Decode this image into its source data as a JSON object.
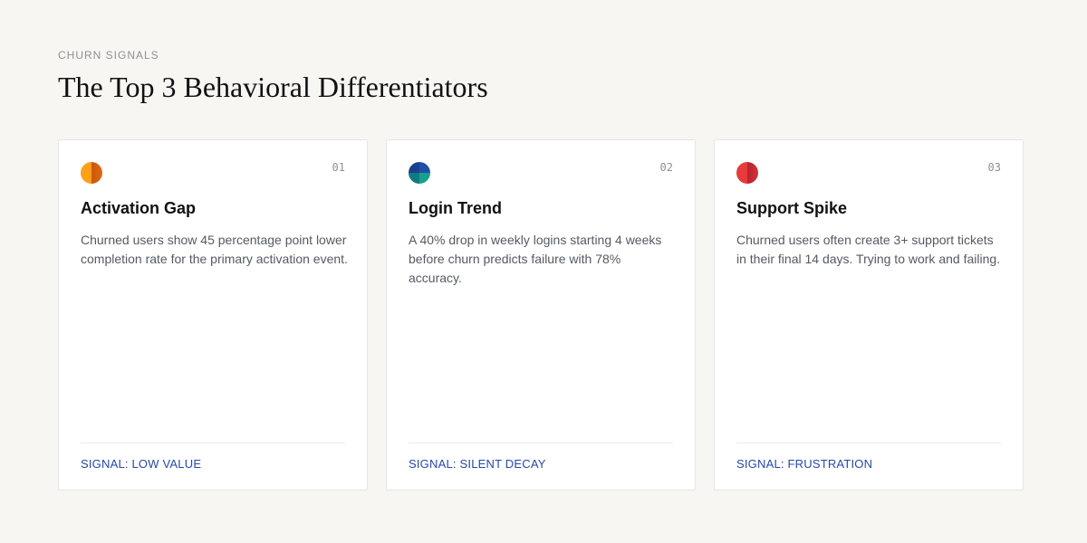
{
  "header": {
    "eyebrow": "CHURN SIGNALS",
    "title": "The Top 3 Behavioral Differentiators"
  },
  "cards": [
    {
      "number": "01",
      "title": "Activation Gap",
      "description": "Churned users show 45 percentage point lower completion rate for the primary activation event.",
      "signal": "SIGNAL: LOW VALUE",
      "icon": "orange-circle-icon",
      "color": "#f08a14"
    },
    {
      "number": "02",
      "title": "Login Trend",
      "description": "A 40% drop in weekly logins starting 4 weeks before churn predicts failure with 78% accuracy.",
      "signal": "SIGNAL: SILENT DECAY",
      "icon": "teal-circle-icon",
      "color": "#1b7f8a"
    },
    {
      "number": "03",
      "title": "Support Spike",
      "description": "Churned users often create 3+ support tickets in their final 14 days. Trying to work and failing.",
      "signal": "SIGNAL: FRUSTRATION",
      "icon": "red-circle-icon",
      "color": "#dc3338"
    }
  ],
  "colors": {
    "background": "#f7f6f3",
    "card": "#ffffff",
    "signal": "#2548a8",
    "muted": "#8e9096"
  }
}
